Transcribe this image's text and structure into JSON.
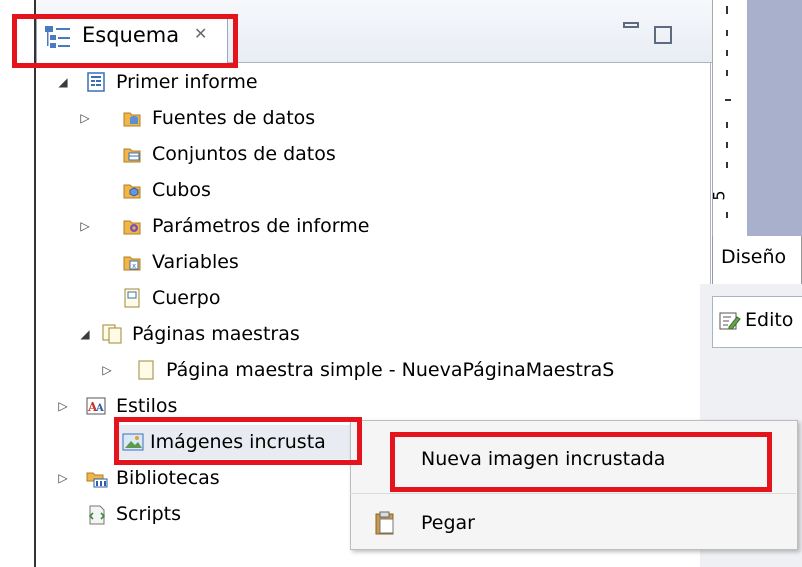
{
  "outline": {
    "tab_label": "Esquema",
    "tree": [
      {
        "label": "Primer informe",
        "twisty": "expanded",
        "icon": "report-icon"
      },
      {
        "label": "Fuentes de datos",
        "twisty": "collapsed",
        "icon": "data-source-icon"
      },
      {
        "label": "Conjuntos de datos",
        "twisty": "none",
        "icon": "data-set-icon"
      },
      {
        "label": "Cubos",
        "twisty": "none",
        "icon": "cube-icon"
      },
      {
        "label": "Parámetros de informe",
        "twisty": "collapsed",
        "icon": "parameter-icon"
      },
      {
        "label": "Variables",
        "twisty": "none",
        "icon": "variable-icon"
      },
      {
        "label": "Cuerpo",
        "twisty": "none",
        "icon": "body-page-icon"
      },
      {
        "label": "Páginas maestras",
        "twisty": "expanded",
        "icon": "master-pages-icon"
      },
      {
        "label": "Página maestra simple - NuevaPáginaMaestraS",
        "twisty": "collapsed",
        "icon": "page-icon"
      },
      {
        "label": "Estilos",
        "twisty": "collapsed",
        "icon": "styles-icon"
      },
      {
        "label": "Imágenes incrusta",
        "twisty": "none",
        "icon": "image-icon"
      },
      {
        "label": "Bibliotecas",
        "twisty": "collapsed",
        "icon": "library-icon"
      },
      {
        "label": "Scripts",
        "twisty": "none",
        "icon": "script-icon"
      }
    ]
  },
  "context_menu": {
    "items": [
      {
        "label": "Nueva imagen incrustada",
        "icon": ""
      },
      {
        "label": "Pegar",
        "icon": "paste-icon"
      }
    ]
  },
  "right_panel": {
    "ruler_tick_label": "5",
    "design_tab": "Diseño",
    "editor_tab": "Edito"
  },
  "colors": {
    "highlight_box": "#e5131b",
    "design_area": "#a9b0cc"
  }
}
